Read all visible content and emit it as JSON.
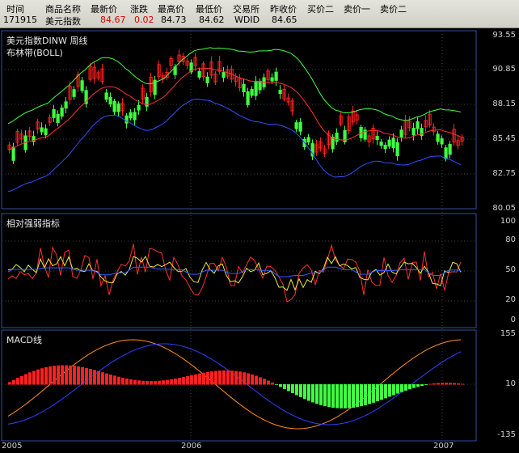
{
  "quote_bar": {
    "headers": [
      "时间",
      "商品名称",
      "最新价",
      "涨跌",
      "最高价",
      "最低价",
      "交易所",
      "昨收价",
      "买价二",
      "卖价一",
      "卖价二"
    ],
    "values": [
      "171915",
      "美元指数",
      "84.67",
      "0.02",
      "84.73",
      "84.62",
      "WDID",
      "84.65",
      "",
      "",
      ""
    ]
  },
  "colors": {
    "up": "#ff2020",
    "down": "#40ff40",
    "upper_band": "#40ff40",
    "mid_band": "#ff3030",
    "lower_band": "#3050ff",
    "frame": "#3050a0",
    "grid": "#404040"
  },
  "panels": {
    "price": {
      "title": "美元指数DINW   周线",
      "subtitle": "布林带(BOLL)",
      "y_ticks": [
        "93.55",
        "90.85",
        "88.15",
        "85.45",
        "82.75",
        "80.05"
      ]
    },
    "rsi": {
      "title": "相对强弱指标",
      "y_ticks": [
        "100",
        "80",
        "50",
        "20",
        "0"
      ]
    },
    "macd": {
      "title": "MACD线",
      "y_ticks": [
        "155",
        "10",
        "-135"
      ]
    }
  },
  "x_axis": {
    "labels": [
      "2005",
      "2006",
      "2007"
    ]
  }
}
